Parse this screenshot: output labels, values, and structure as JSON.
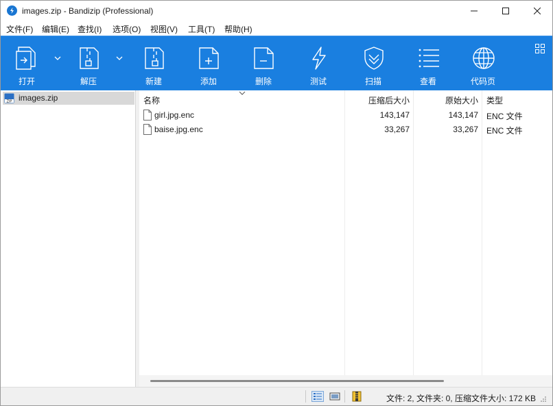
{
  "window": {
    "title": "images.zip - Bandizip (Professional)",
    "accent_color": "#1a7fe0"
  },
  "menu": [
    "文件(F)",
    "编辑(E)",
    "查找(I)",
    "选项(O)",
    "视图(V)",
    "工具(T)",
    "帮助(H)"
  ],
  "toolbar": {
    "open": "打开",
    "extract": "解压",
    "new": "新建",
    "add": "添加",
    "delete": "删除",
    "test": "测试",
    "scan": "扫描",
    "view": "查看",
    "codepage": "代码页"
  },
  "tree": {
    "root": "images.zip"
  },
  "columns": {
    "name": "名称",
    "compressed": "压缩后大小",
    "original": "原始大小",
    "type": "类型"
  },
  "files": [
    {
      "name": "girl.jpg.enc",
      "compressed": "143,147",
      "original": "143,147",
      "type": "ENC 文件"
    },
    {
      "name": "baise.jpg.enc",
      "compressed": "33,267",
      "original": "33,267",
      "type": "ENC 文件"
    }
  ],
  "status": {
    "summary": "文件: 2, 文件夹: 0, 压缩文件大小: 172 KB"
  },
  "icons": {
    "open": "open-icon",
    "extract": "zip-extract-icon",
    "new": "new-archive-icon",
    "add": "add-file-icon",
    "delete": "delete-file-icon",
    "test": "lightning-test-icon",
    "scan": "shield-scan-icon",
    "view": "list-view-icon",
    "codepage": "globe-icon"
  }
}
